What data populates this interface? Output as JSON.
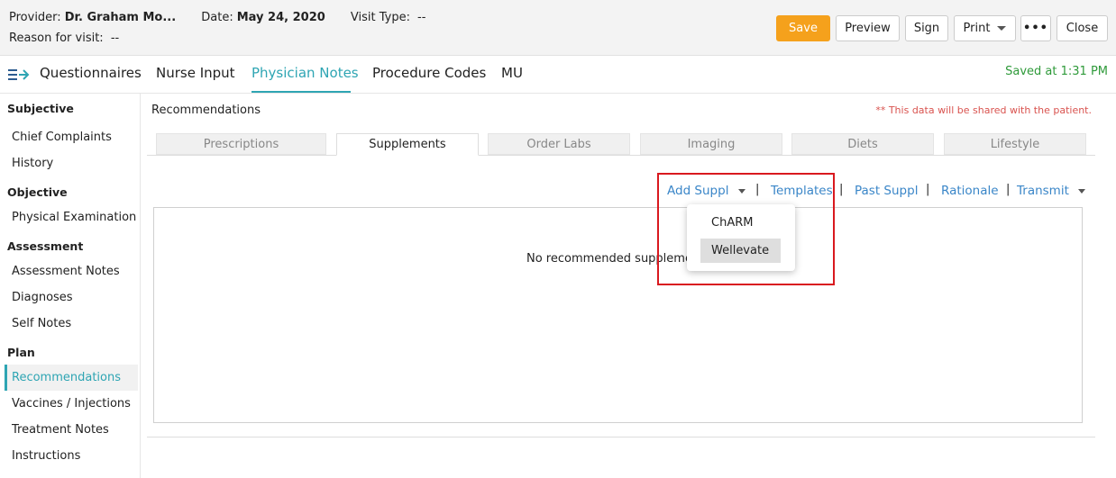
{
  "header": {
    "provider_label": "Provider:",
    "provider_value": "Dr. Graham Mo...",
    "date_label": "Date:",
    "date_value": "May 24, 2020",
    "visit_type_label": "Visit Type:",
    "visit_type_value": "--",
    "reason_label": "Reason for visit:",
    "reason_value": "--",
    "buttons": {
      "save": "Save",
      "preview": "Preview",
      "sign": "Sign",
      "print": "Print",
      "more": "•••",
      "close": "Close"
    }
  },
  "tabs": {
    "items": [
      "Questionnaires",
      "Nurse Input",
      "Physician Notes",
      "Procedure Codes",
      "MU"
    ],
    "active": "Physician Notes",
    "saved_status": "Saved at 1:31 PM"
  },
  "sidebar": {
    "sections": [
      {
        "heading": "Subjective",
        "items": [
          "Chief Complaints",
          "History"
        ]
      },
      {
        "heading": "Objective",
        "items": [
          "Physical Examination"
        ]
      },
      {
        "heading": "Assessment",
        "items": [
          "Assessment Notes",
          "Diagnoses",
          "Self Notes"
        ]
      },
      {
        "heading": "Plan",
        "items": [
          "Recommendations",
          "Vaccines / Injections",
          "Treatment Notes",
          "Instructions"
        ]
      }
    ],
    "active_item": "Recommendations"
  },
  "main": {
    "title": "Recommendations",
    "notice": "** This data will be shared with the patient.",
    "subtabs": [
      "Prescriptions",
      "Supplements",
      "Order Labs",
      "Imaging",
      "Diets",
      "Lifestyle"
    ],
    "active_subtab": "Supplements",
    "actions": {
      "add_suppl": "Add Suppl",
      "templates": "Templates",
      "past_suppl": "Past Suppl",
      "rationale": "Rationale",
      "transmit": "Transmit",
      "separator": "|"
    },
    "empty_message": "No recommended supplements",
    "dropdown": {
      "items": [
        "ChARM",
        "Wellevate"
      ],
      "highlighted": "Wellevate"
    }
  },
  "colors": {
    "accent": "#2ea5b3",
    "save_button": "#f5a11c",
    "saved_status": "#2f9a3a",
    "notice": "#d9534f",
    "link": "#3a86c8",
    "highlight_box": "#d9191f"
  }
}
